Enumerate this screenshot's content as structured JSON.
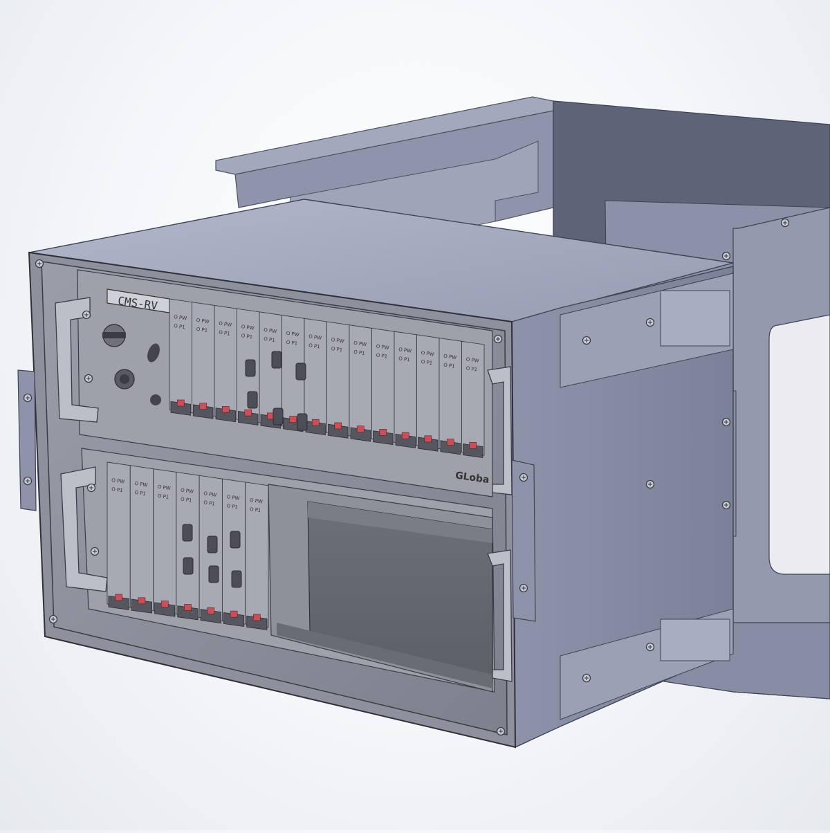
{
  "model": {
    "nameplate": "CMS-RV",
    "brand_mark": "GLoba",
    "upper_rack": {
      "card_count": 14,
      "card_label_lines": [
        "O PW",
        "O P1"
      ]
    },
    "lower_rack": {
      "card_count": 7,
      "card_label_lines": [
        "O PW",
        "O P1"
      ]
    }
  },
  "colors": {
    "frame": "#9aa0b6",
    "frame_dark": "#5c6074",
    "frame_light": "#b3b8cc",
    "enclosure_top": "#a4a9be",
    "enclosure_side": "#8d92a8",
    "glass": "#8b8e9c",
    "card": "#a7a9b3",
    "latch_red": "#c8505a",
    "screw": "#3a3c44"
  },
  "icons": [
    "screw-icon",
    "key-switch-icon",
    "round-connector-icon",
    "rj45-port-icon",
    "db9-port-icon",
    "handle-icon"
  ]
}
